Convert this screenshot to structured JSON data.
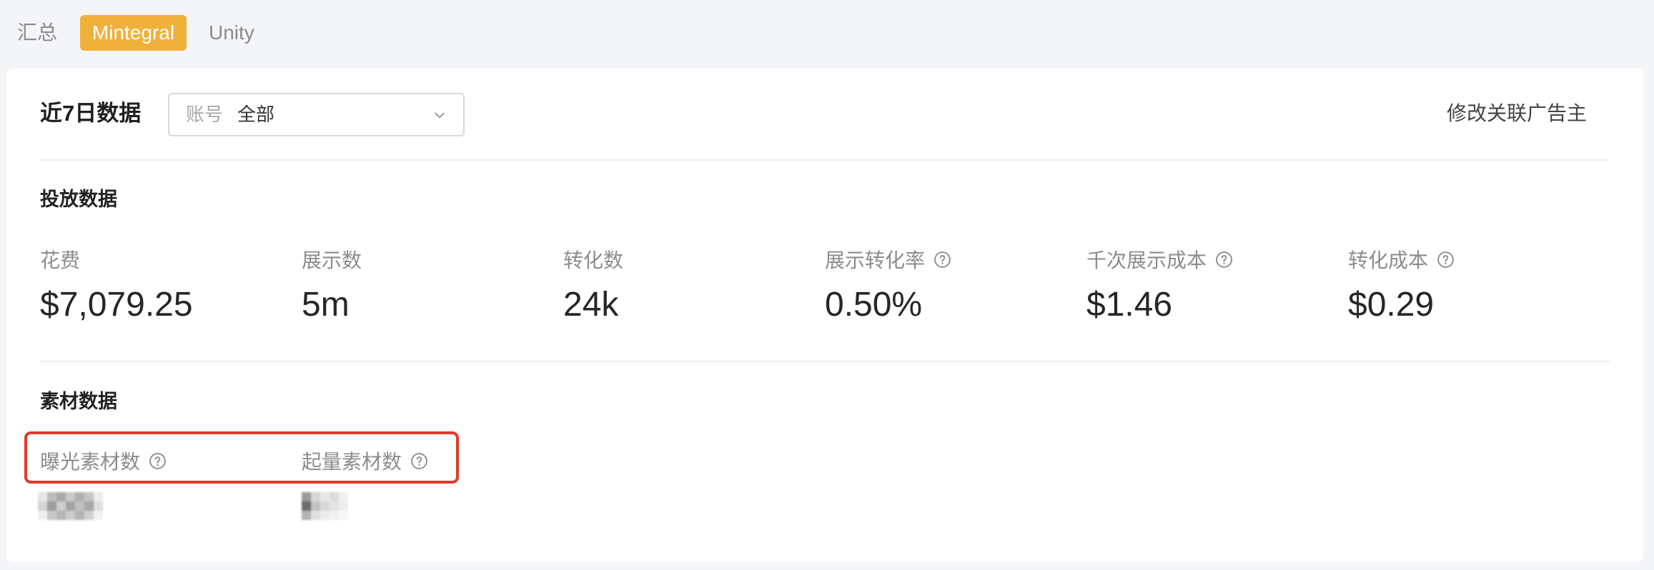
{
  "tabs": [
    {
      "label": "汇总",
      "active": false
    },
    {
      "label": "Mintegral",
      "active": true
    },
    {
      "label": "Unity",
      "active": false
    }
  ],
  "header": {
    "title": "近7日数据",
    "account_select": {
      "label": "账号",
      "value": "全部"
    },
    "edit_link": "修改关联广告主"
  },
  "delivery": {
    "title": "投放数据",
    "metrics": [
      {
        "label": "花费",
        "value": "$7,079.25",
        "has_help": false
      },
      {
        "label": "展示数",
        "value": "5m",
        "has_help": false
      },
      {
        "label": "转化数",
        "value": "24k",
        "has_help": false
      },
      {
        "label": "展示转化率",
        "value": "0.50%",
        "has_help": true
      },
      {
        "label": "千次展示成本",
        "value": "$1.46",
        "has_help": true
      },
      {
        "label": "转化成本",
        "value": "$0.29",
        "has_help": true
      }
    ]
  },
  "material": {
    "title": "素材数据",
    "metrics": [
      {
        "label": "曝光素材数",
        "has_help": true
      },
      {
        "label": "起量素材数",
        "has_help": true
      }
    ]
  },
  "colors": {
    "accent": "#f0b13a",
    "highlight_border": "#de3a2e",
    "page_background": "#f4f5f8",
    "card_background": "#ffffff"
  },
  "icons": {
    "help": "question-circle-icon",
    "select_arrow": "chevron-down-icon"
  }
}
